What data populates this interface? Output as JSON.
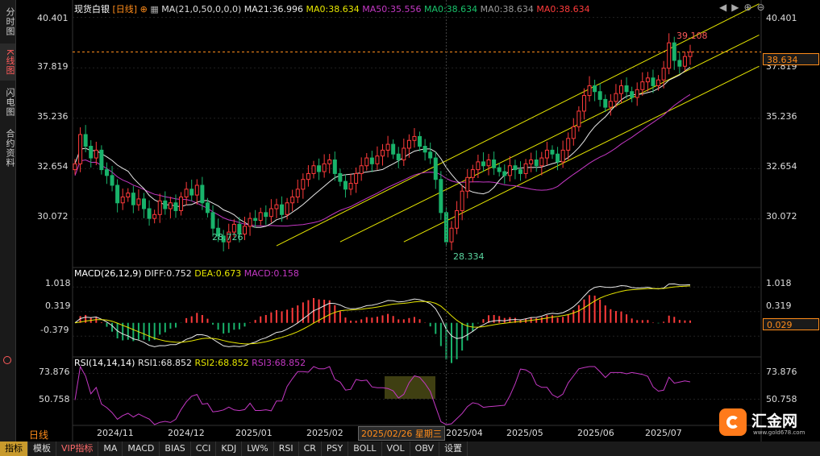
{
  "sidebar": {
    "tabs": [
      {
        "label": "分时图",
        "active": false
      },
      {
        "label": "K线图",
        "active": true
      },
      {
        "label": "闪电图",
        "active": false
      },
      {
        "label": "合约资料",
        "active": false
      }
    ]
  },
  "header": {
    "instrument": "现货白银",
    "period_label": "[日线]",
    "ma_main": "MA(21,0,50,0,0,0)",
    "ma21": "MA21:36.996",
    "ma0a": "MA0:38.634",
    "ma50": "MA50:35.556",
    "ma0b": "MA0:38.634",
    "ma0c": "MA0:38.634",
    "ma0d": "MA0:38.634"
  },
  "macd_header": {
    "name": "MACD(26,12,9)",
    "diff": "DIFF:0.752",
    "dea": "DEA:0.673",
    "macd": "MACD:0.158"
  },
  "rsi_header": {
    "name": "RSI(14,14,14)",
    "rsi1": "RSI1:68.852",
    "rsi2": "RSI2:68.852",
    "rsi3": "RSI3:68.852"
  },
  "price_axis": [
    "40.401",
    "37.819",
    "35.236",
    "32.654",
    "30.072"
  ],
  "price_axis_right": [
    "40.401",
    "37.819",
    "35.236",
    "32.654",
    "30.072"
  ],
  "macd_axis": [
    "1.018",
    "0.319",
    "-0.379"
  ],
  "rsi_axis": [
    "73.876",
    "50.758"
  ],
  "current_price": "38.634",
  "current_macd": "0.029",
  "annotations": {
    "high": "39.108",
    "low1": "28.726",
    "low2": "28.334"
  },
  "x_labels": [
    "2024/11",
    "2024/12",
    "2025/01",
    "2025/02",
    "2025/04",
    "2025/05",
    "2025/06",
    "2025/07"
  ],
  "cursor_label": "2025/02/26 星期三",
  "period_name": "日线",
  "toolbar": {
    "items": [
      "指标",
      "模板",
      "VIP指标",
      "MA",
      "MACD",
      "BIAS",
      "CCI",
      "KDJ",
      "LW%",
      "RSI",
      "CR",
      "PSY",
      "BOLL",
      "VOL",
      "OBV",
      "设置"
    ]
  },
  "brand": {
    "name": "汇金网",
    "url": "www.gold678.com"
  },
  "colors": {
    "up": "#ff3b3b",
    "down": "#19b36b",
    "ma21": "#e8e8e8",
    "ma50": "#c438c4",
    "channel": "#e6e600",
    "dea": "#e6e600",
    "rsi": "#c438c4",
    "price_line": "#ff8c1a"
  },
  "chart_data": {
    "type": "candlestick",
    "instrument": "现货白银",
    "period": "日线",
    "x": [
      "2024/11",
      "2024/12",
      "2025/01",
      "2025/02",
      "2025/04",
      "2025/05",
      "2025/06",
      "2025/07"
    ],
    "price_ylim": [
      28.0,
      40.8
    ],
    "price_ticks": [
      40.401,
      37.819,
      35.236,
      32.654,
      30.072
    ],
    "close_series": [
      32.9,
      34.4,
      33.8,
      33.2,
      33.6,
      32.6,
      32.3,
      31.8,
      30.9,
      31.2,
      31.4,
      30.8,
      31.1,
      30.6,
      30.1,
      30.3,
      31.0,
      30.6,
      30.9,
      30.5,
      31.2,
      31.6,
      31.3,
      31.8,
      30.9,
      30.4,
      29.6,
      29.2,
      28.9,
      29.4,
      29.8,
      29.3,
      29.7,
      30.1,
      30.0,
      30.4,
      30.2,
      30.6,
      30.8,
      30.3,
      30.9,
      31.2,
      31.6,
      32.1,
      32.4,
      32.8,
      32.5,
      32.9,
      33.1,
      32.4,
      32.0,
      31.6,
      31.9,
      32.4,
      32.8,
      33.2,
      32.9,
      33.3,
      33.6,
      33.9,
      33.4,
      33.1,
      33.7,
      34.1,
      34.3,
      33.8,
      33.5,
      33.2,
      32.1,
      30.4,
      28.9,
      29.6,
      30.5,
      31.5,
      32.2,
      32.6,
      33.0,
      32.8,
      33.1,
      32.7,
      32.5,
      32.3,
      32.8,
      32.6,
      32.4,
      32.9,
      33.1,
      32.8,
      33.2,
      33.6,
      33.4,
      33.0,
      33.6,
      34.2,
      34.8,
      35.6,
      36.4,
      36.9,
      36.6,
      36.2,
      35.8,
      36.1,
      36.5,
      36.9,
      36.6,
      36.3,
      36.7,
      37.1,
      37.3,
      36.9,
      37.2,
      37.8,
      39.1,
      38.2,
      37.9,
      38.4,
      38.63
    ],
    "ma21_last": 36.996,
    "ma50_last": 35.556,
    "current": 38.634,
    "high_annotation": 39.108,
    "low_annotations": [
      28.726,
      28.334
    ],
    "macd": {
      "params": "26,12,9",
      "diff": 0.752,
      "dea": 0.673,
      "macd": 0.158,
      "ylim": [
        -0.9,
        1.3
      ],
      "ticks": [
        1.018,
        0.319,
        -0.379
      ],
      "current": 0.029
    },
    "rsi": {
      "params": "14,14,14",
      "rsi1": 68.852,
      "rsi2": 68.852,
      "rsi3": 68.852,
      "ylim": [
        28,
        80
      ],
      "ticks": [
        73.876,
        50.758
      ]
    }
  }
}
